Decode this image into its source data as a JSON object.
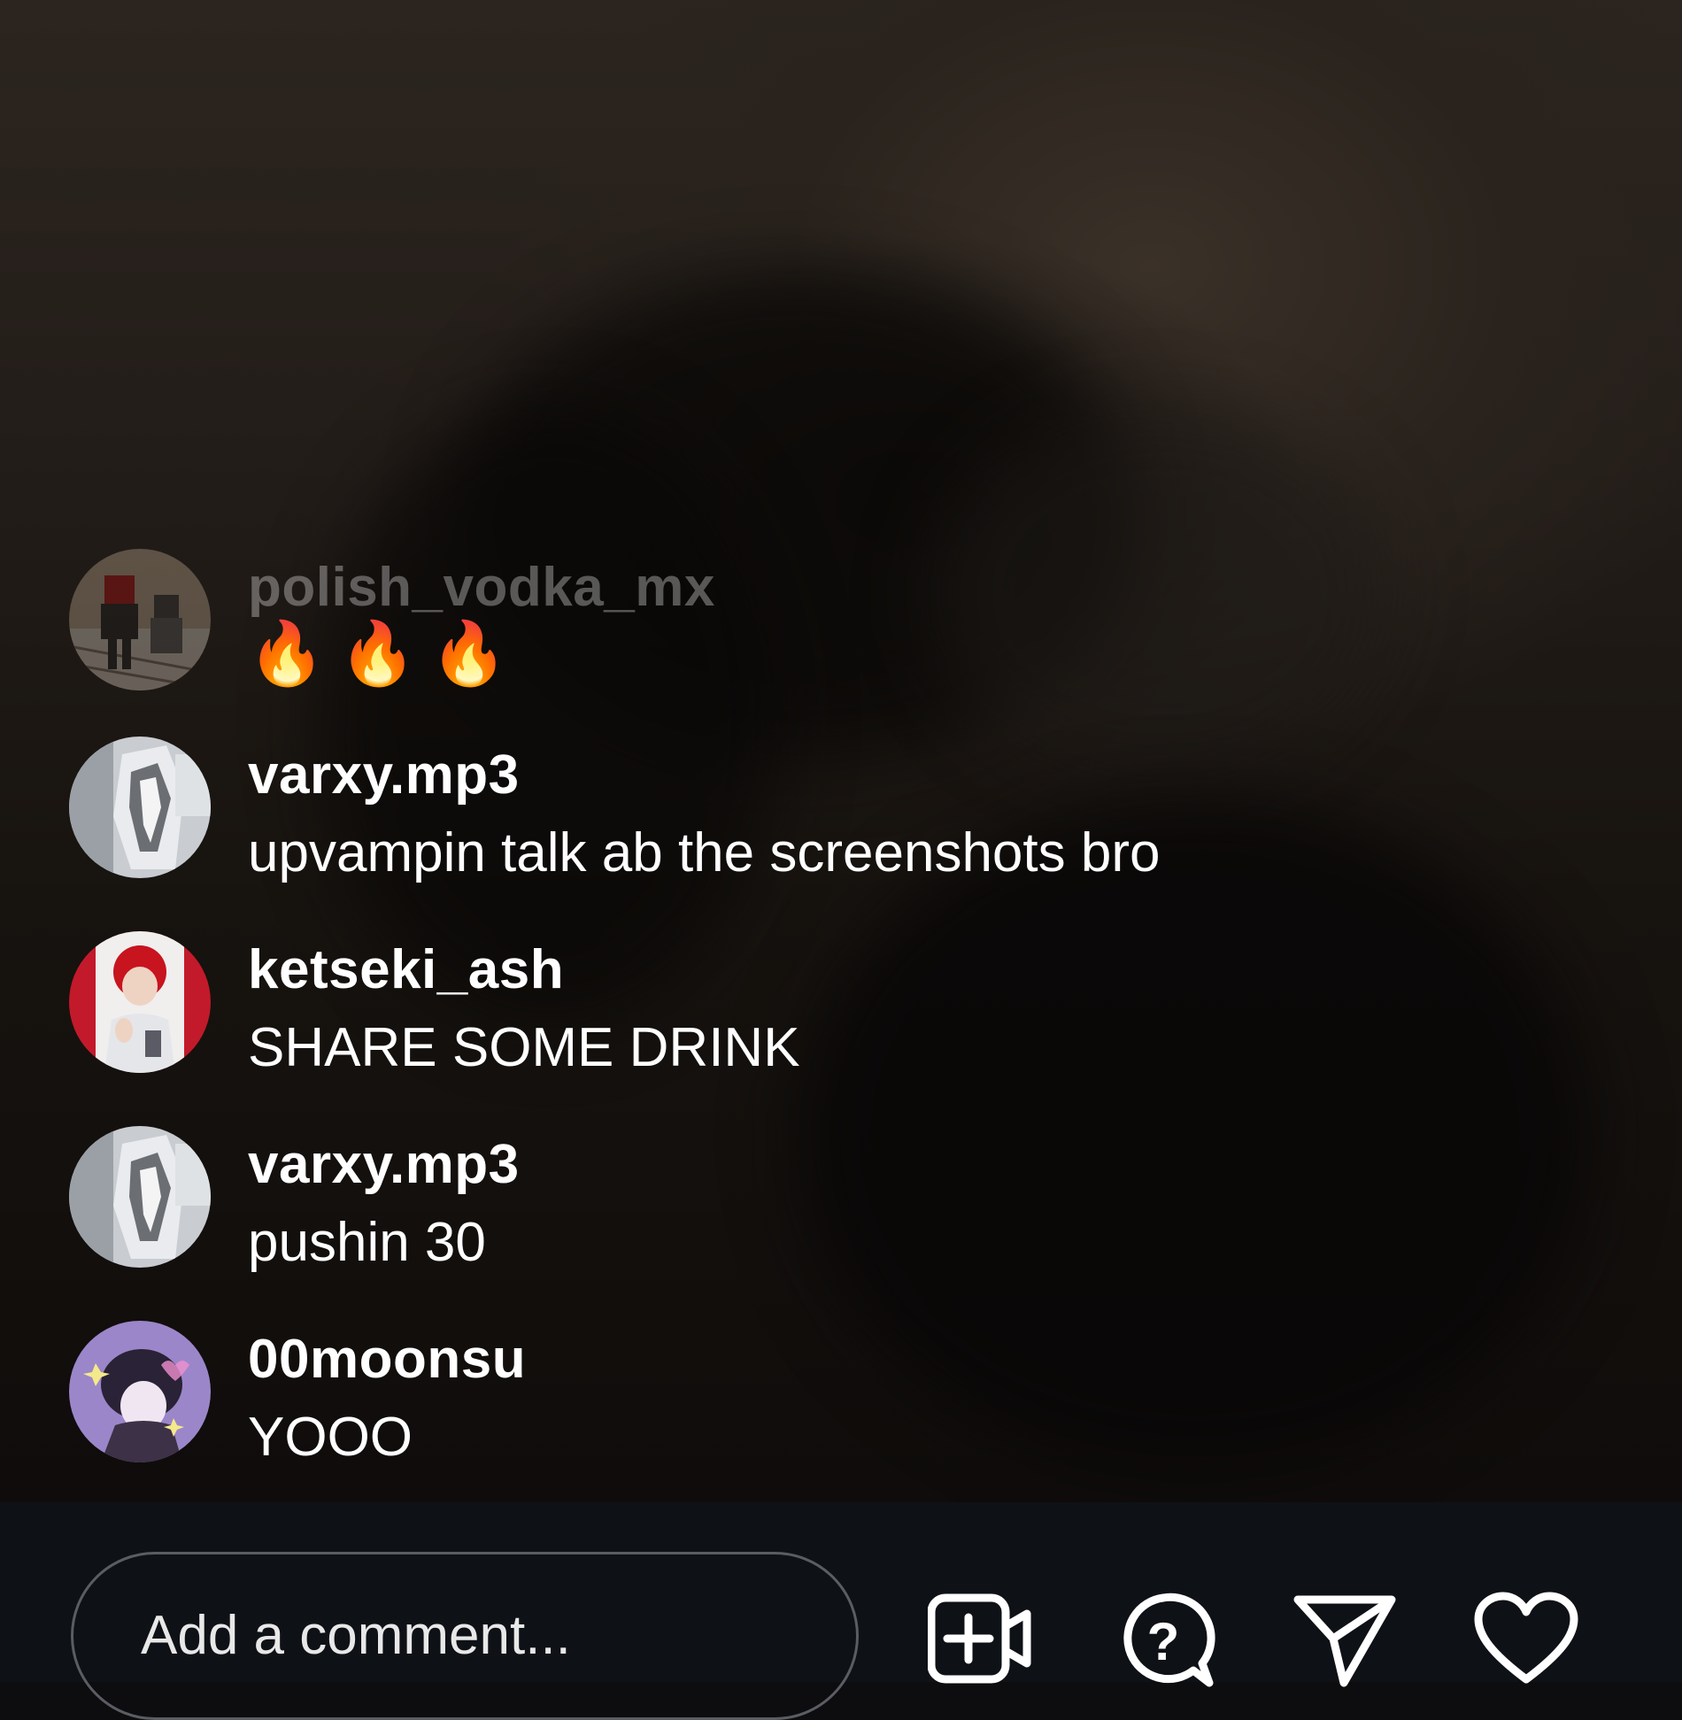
{
  "comments": [
    {
      "username": "polish_vodka_mx",
      "message": "🔥🔥🔥",
      "faded": true
    },
    {
      "username": "varxy.mp3",
      "message": "upvampin talk ab the screenshots bro"
    },
    {
      "username": "ketseki_ash",
      "message": "SHARE SOME DRINK"
    },
    {
      "username": "varxy.mp3",
      "message": "pushin 30"
    },
    {
      "username": "00moonsu",
      "message": "YOOO"
    }
  ],
  "composer": {
    "placeholder": "Add a comment..."
  },
  "icons": {
    "add_guest": "video-plus-icon",
    "question": "question-bubble-icon",
    "share": "paper-plane-icon",
    "like": "heart-icon"
  },
  "colors": {
    "text": "#ffffff",
    "bar_bg": "#0e1116",
    "input_border": "#5a5d63"
  }
}
